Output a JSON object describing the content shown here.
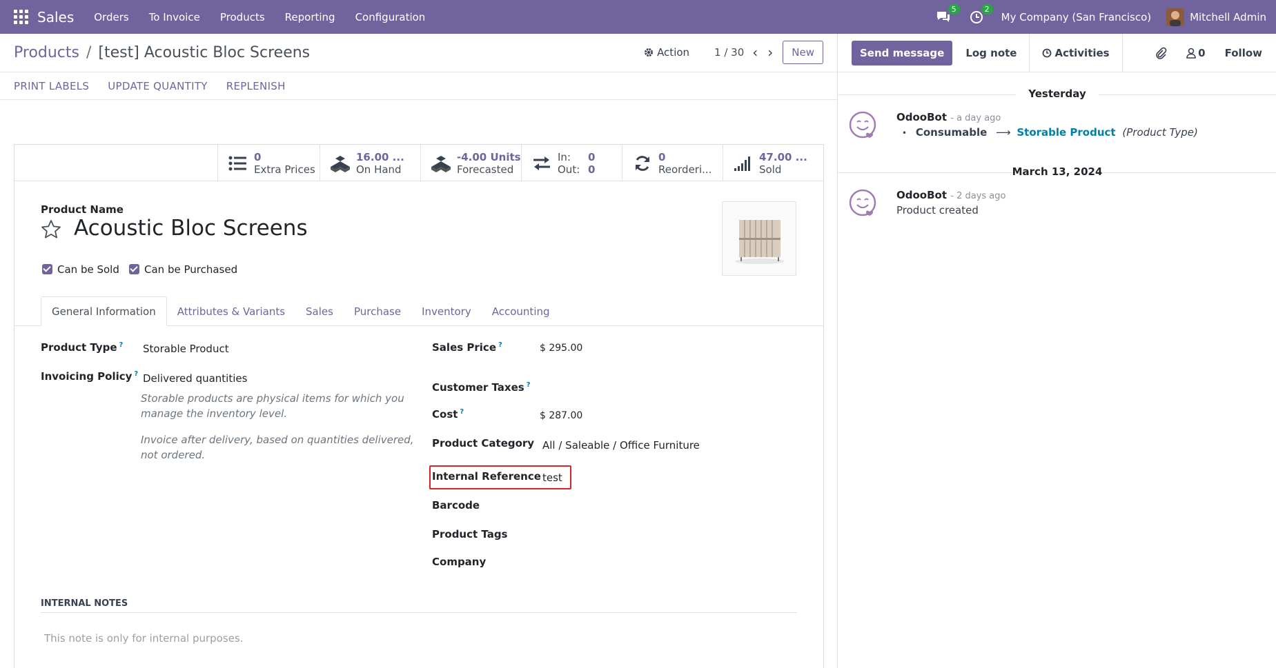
{
  "topbar": {
    "app_name": "Sales",
    "menu": [
      "Orders",
      "To Invoice",
      "Products",
      "Reporting",
      "Configuration"
    ],
    "messages_count": "5",
    "activities_count": "2",
    "company": "My Company (San Francisco)",
    "user": "Mitchell Admin"
  },
  "breadcrumb": {
    "parent": "Products",
    "separator": "/",
    "current": "[test] Acoustic Bloc Screens"
  },
  "controls": {
    "action": "Action",
    "pager": "1 / 30",
    "new": "New"
  },
  "statusbar": [
    "PRINT LABELS",
    "UPDATE QUANTITY",
    "REPLENISH"
  ],
  "smart_buttons": {
    "extra_prices": {
      "value": "0",
      "label": "Extra Prices"
    },
    "on_hand": {
      "value": "16.00 ...",
      "label": "On Hand"
    },
    "forecasted": {
      "value": "-4.00 Units",
      "label": "Forecasted"
    },
    "in_out": {
      "in_label": "In:",
      "in_value": "0",
      "out_label": "Out:",
      "out_value": "0"
    },
    "reordering": {
      "value": "0",
      "label": "Reorderi..."
    },
    "sold": {
      "value": "47.00 ...",
      "label": "Sold"
    }
  },
  "product": {
    "name_label": "Product Name",
    "name": "Acoustic Bloc Screens",
    "can_be_sold": "Can be Sold",
    "can_be_purchased": "Can be Purchased"
  },
  "tabs": [
    "General Information",
    "Attributes & Variants",
    "Sales",
    "Purchase",
    "Inventory",
    "Accounting"
  ],
  "general": {
    "product_type_label": "Product Type",
    "product_type": "Storable Product",
    "invoicing_policy_label": "Invoicing Policy",
    "invoicing_policy": "Delivered quantities",
    "hint1": "Storable products are physical items for which you manage the inventory level.",
    "hint2": "Invoice after delivery, based on quantities delivered, not ordered.",
    "sales_price_label": "Sales Price",
    "sales_price": "$ 295.00",
    "customer_taxes_label": "Customer Taxes",
    "cost_label": "Cost",
    "cost": "$ 287.00",
    "category_label": "Product Category",
    "category": "All / Saleable / Office Furniture",
    "internal_ref_label": "Internal Reference",
    "internal_ref": "test",
    "barcode_label": "Barcode",
    "tags_label": "Product Tags",
    "company_label": "Company",
    "help_marker": "?"
  },
  "notes": {
    "title": "INTERNAL NOTES",
    "placeholder": "This note is only for internal purposes."
  },
  "chatter": {
    "send_message": "Send message",
    "log_note": "Log note",
    "activities": "Activities",
    "followers_count": "0",
    "follow": "Follow",
    "groups": [
      {
        "date": "Yesterday",
        "author": "OdooBot",
        "when": "- a day ago",
        "from": "Consumable",
        "to": "Storable Product",
        "field": "(Product Type)"
      },
      {
        "date": "March 13, 2024",
        "author": "OdooBot",
        "when": "- 2 days ago",
        "body": "Product created"
      }
    ]
  },
  "colors": {
    "brand": "#71639e",
    "link": "#0180a5",
    "badge": "#28a745",
    "highlight": "#d9232e"
  }
}
